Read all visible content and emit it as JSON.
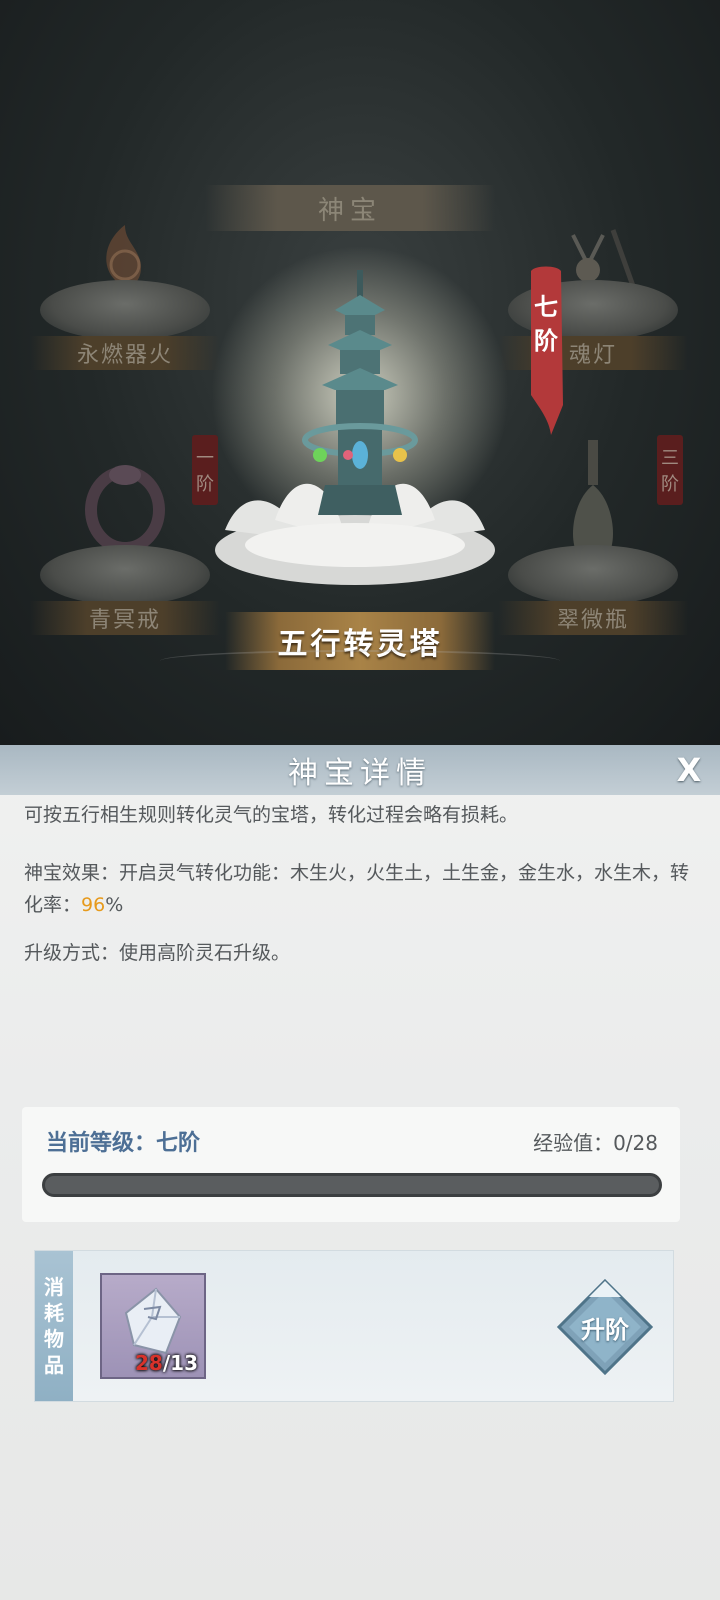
{
  "top": {
    "tab_title": "神宝",
    "items": [
      {
        "name": "永燃器火",
        "tier": ""
      },
      {
        "name": "魂灯",
        "tier": ""
      },
      {
        "name": "青冥戒",
        "tier": "一阶"
      },
      {
        "name": "翠微瓶",
        "tier": "三阶"
      }
    ],
    "selected": {
      "name": "五行转灵塔",
      "tier_line1": "七",
      "tier_line2": "阶"
    }
  },
  "panel": {
    "title": "神宝详情",
    "close_label": "X",
    "description": "可按五行相生规则转化灵气的宝塔，转化过程会略有损耗。",
    "effect_prefix": "神宝效果：开启灵气转化功能：木生火，火生土，土生金，金生水，水生木，转化率：",
    "effect_rate": "96",
    "effect_suffix": "%",
    "upgrade_method": "升级方式：使用高阶灵石升级。",
    "level_label": "当前等级：七阶",
    "exp_label": "经验值：0/28",
    "exp_progress": 0,
    "consume": {
      "tag_chars": [
        "消",
        "耗",
        "物",
        "品"
      ],
      "item_have": "28",
      "item_need": "/13",
      "upgrade_label": "升阶"
    }
  },
  "colors": {
    "highlight": "#e79a1c",
    "level_text": "#4d6f95",
    "count_red": "#d8322b"
  }
}
